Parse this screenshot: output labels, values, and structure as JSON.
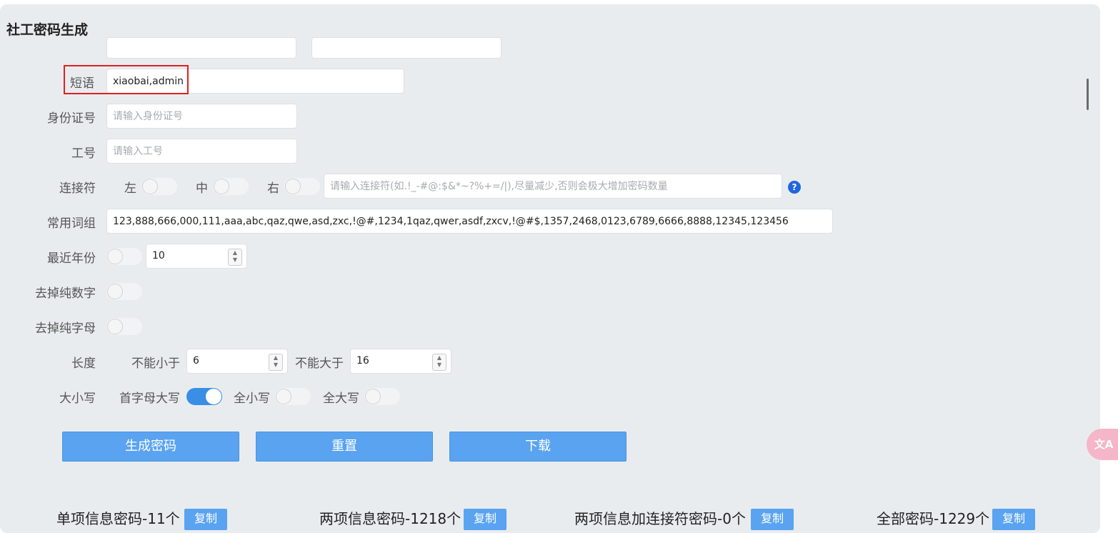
{
  "page": {
    "title": "社工密码生成"
  },
  "form": {
    "phrase": {
      "label": "短语",
      "value": "xiaobai,admin"
    },
    "id_card": {
      "label": "身份证号",
      "placeholder": "请输入身份证号"
    },
    "employee_id": {
      "label": "工号",
      "placeholder": "请输入工号"
    },
    "connector": {
      "label": "连接符",
      "left_label": "左",
      "middle_label": "中",
      "right_label": "右",
      "placeholder": "请输入连接符(如.!_-#@:$&*~?%+=/|),尽量减少,否则会极大增加密码数量",
      "help_icon": "question-icon",
      "help_text": "?"
    },
    "common_words": {
      "label": "常用词组",
      "value": "123,888,666,000,111,aaa,abc,qaz,qwe,asd,zxc,!@#,1234,1qaz,qwer,asdf,zxcv,!@#$,1357,2468,0123,6789,6666,8888,12345,123456"
    },
    "recent_years": {
      "label": "最近年份",
      "value": "10"
    },
    "remove_pure_digits": {
      "label": "去掉纯数字"
    },
    "remove_pure_letters": {
      "label": "去掉纯字母"
    },
    "length": {
      "label": "长度",
      "min_label": "不能小于",
      "min_value": "6",
      "max_label": "不能大于",
      "max_value": "16"
    },
    "case": {
      "label": "大小写",
      "capitalize_label": "首字母大写",
      "lower_label": "全小写",
      "upper_label": "全大写"
    }
  },
  "toggles": {
    "connector_left": false,
    "connector_middle": false,
    "connector_right": false,
    "recent_years": false,
    "remove_pure_digits": false,
    "remove_pure_letters": false,
    "capitalize": true,
    "lower": false,
    "upper": false
  },
  "actions": {
    "generate": "生成密码",
    "reset": "重置",
    "download": "下载"
  },
  "results": {
    "single": "单项信息密码-11个",
    "double": "两项信息密码-1218个",
    "double_connector": "两项信息加连接符密码-0个",
    "all": "全部密码-1229个",
    "copy": "复制"
  },
  "fab": {
    "icon": "translate-icon",
    "text": "文A"
  },
  "colors": {
    "primary": "#5aa3f0",
    "toggle_on": "#3a8ee6",
    "highlight_border": "#e02020",
    "panel_bg": "#e9ecef"
  }
}
